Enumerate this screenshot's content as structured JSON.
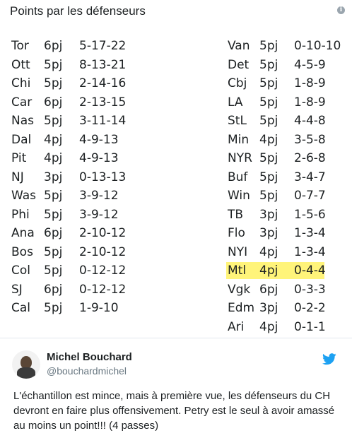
{
  "media": {
    "title": "Points par les défenseurs",
    "info_icon": "info-icon"
  },
  "stats": {
    "left": [
      {
        "team": "Tor",
        "gp": "6pj",
        "pts": "5-17-22"
      },
      {
        "team": "Ott",
        "gp": "5pj",
        "pts": "8-13-21"
      },
      {
        "team": "Chi",
        "gp": "5pj",
        "pts": "2-14-16"
      },
      {
        "team": "Car",
        "gp": "6pj",
        "pts": "2-13-15"
      },
      {
        "team": "Nas",
        "gp": "5pj",
        "pts": "3-11-14"
      },
      {
        "team": "Dal",
        "gp": "4pj",
        "pts": "4-9-13"
      },
      {
        "team": "Pit",
        "gp": "4pj",
        "pts": "4-9-13"
      },
      {
        "team": "NJ",
        "gp": "3pj",
        "pts": "0-13-13"
      },
      {
        "team": "Was",
        "gp": "5pj",
        "pts": "3-9-12"
      },
      {
        "team": "Phi",
        "gp": "5pj",
        "pts": "3-9-12"
      },
      {
        "team": "Ana",
        "gp": "6pj",
        "pts": "2-10-12"
      },
      {
        "team": "Bos",
        "gp": "5pj",
        "pts": "2-10-12"
      },
      {
        "team": "Col",
        "gp": "5pj",
        "pts": "0-12-12"
      },
      {
        "team": "SJ",
        "gp": "6pj",
        "pts": "0-12-12"
      },
      {
        "team": "Cal",
        "gp": "5pj",
        "pts": "1-9-10"
      }
    ],
    "right": [
      {
        "team": "Van",
        "gp": "5pj",
        "pts": "0-10-10"
      },
      {
        "team": "Det",
        "gp": "5pj",
        "pts": "4-5-9"
      },
      {
        "team": "Cbj",
        "gp": "5pj",
        "pts": "1-8-9"
      },
      {
        "team": "LA",
        "gp": "5pj",
        "pts": "1-8-9"
      },
      {
        "team": "StL",
        "gp": "5pj",
        "pts": "4-4-8"
      },
      {
        "team": "Min",
        "gp": "4pj",
        "pts": "3-5-8"
      },
      {
        "team": "NYR",
        "gp": "5pj",
        "pts": "2-6-8"
      },
      {
        "team": "Buf",
        "gp": "5pj",
        "pts": "3-4-7"
      },
      {
        "team": "Win",
        "gp": "5pj",
        "pts": "0-7-7"
      },
      {
        "team": "TB",
        "gp": "3pj",
        "pts": "1-5-6"
      },
      {
        "team": "Flo",
        "gp": "3pj",
        "pts": "1-3-4"
      },
      {
        "team": "NYI",
        "gp": "4pj",
        "pts": "1-3-4"
      },
      {
        "team": "Mtl",
        "gp": "4pj",
        "pts": "0-4-4",
        "highlight": true
      },
      {
        "team": "Vgk",
        "gp": "6pj",
        "pts": "0-3-3"
      },
      {
        "team": "Edm",
        "gp": "3pj",
        "pts": "0-2-2"
      },
      {
        "team": "Ari",
        "gp": "4pj",
        "pts": "0-1-1"
      }
    ],
    "highlight_color": "#fff47a"
  },
  "tweet": {
    "author_name": "Michel Bouchard",
    "author_handle": "@bouchardmichel",
    "avatar_icon": "avatar",
    "platform_icon": "twitter-bird-icon",
    "text": "L'échantillon est mince, mais à première vue, les défenseurs du CH devront en faire plus offensivement. Petry est le seul à avoir amassé au moins un point!!! (4 passes)",
    "brand_color": "#1da1f2"
  }
}
